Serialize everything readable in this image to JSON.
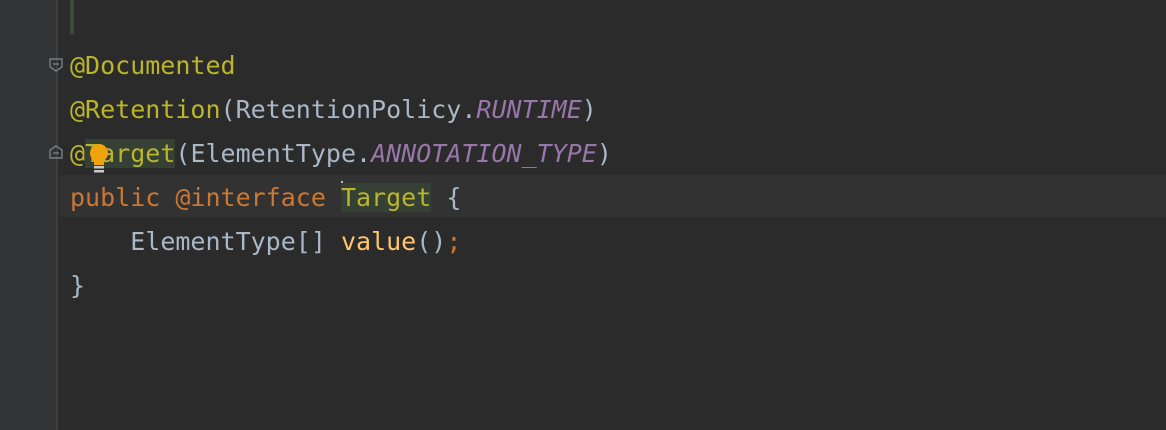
{
  "editor": {
    "lines": [
      {
        "annotation": "@Documented"
      },
      {
        "annotation": "@Retention",
        "open": "(",
        "type": "RetentionPolicy",
        "dot": ".",
        "constant": "RUNTIME",
        "close": ")"
      },
      {
        "at": "@",
        "name": "Target",
        "open": "(",
        "type": "ElementType",
        "dot": ".",
        "constant": "ANNOTATION_TYPE",
        "close": ")"
      },
      {
        "kw_public": "public",
        "kw_interface": "@interface",
        "name": "Target",
        "brace": "{"
      },
      {
        "indent": "    ",
        "type": "ElementType[]",
        "method": "value",
        "parens": "()",
        "semi": ";"
      },
      {
        "brace": "}"
      }
    ],
    "colors": {
      "background": "#2b2b2b",
      "annotation": "#bbb529",
      "keyword": "#cc7832",
      "constant": "#9876aa",
      "method": "#ffc66d",
      "text": "#a9b7c6",
      "highlight": "#344134"
    },
    "icons": [
      "fold-icon",
      "lightbulb-icon"
    ]
  }
}
